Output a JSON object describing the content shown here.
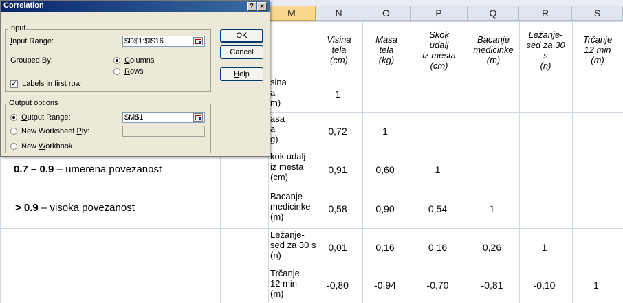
{
  "columns": [
    "M",
    "N",
    "O",
    "P",
    "Q",
    "R",
    "S"
  ],
  "active_column": "M",
  "headers": [
    [
      "Visina",
      "tela",
      "(cm)"
    ],
    [
      "Masa",
      "tela",
      "(kg)"
    ],
    [
      "Skok",
      "udalj",
      "iz mesta",
      "(cm)"
    ],
    [
      "Bacanje",
      "medicinke",
      "(m)"
    ],
    [
      "Ležanje-",
      "sed za 30",
      "s",
      "(n)"
    ],
    [
      "Trčanje",
      "12 min",
      "(m)"
    ]
  ],
  "row_labels": [
    [
      "sina",
      "a",
      "m)"
    ],
    [
      "asa",
      "a",
      "g)"
    ],
    [
      "kok udalj",
      "iz mesta",
      "(cm)"
    ],
    [
      "Bacanje",
      "medicinke",
      "(m)"
    ],
    [
      "Ležanje-",
      "sed za 30 s",
      "(n)"
    ],
    [
      "Trčanje",
      "12 min",
      "(m)"
    ]
  ],
  "matrix": [
    [
      "1"
    ],
    [
      "0,72",
      "1"
    ],
    [
      "0,91",
      "0,60",
      "1"
    ],
    [
      "0,58",
      "0,90",
      "0,54",
      "1"
    ],
    [
      "0,01",
      "0,16",
      "0,16",
      "0,26",
      "1"
    ],
    [
      "-0,80",
      "-0,94",
      "-0,70",
      "-0,81",
      "-0,10",
      "1"
    ]
  ],
  "legend": [
    {
      "bold": "0.7 – 0.9",
      "text": " – umerena povezanost"
    },
    {
      "bold": "> 0.9",
      "text": " – visoka povezanost"
    }
  ],
  "dialog": {
    "title": "Correlation",
    "help_btn": "?",
    "close_btn": "×",
    "input_group": "Input",
    "input_range_label": "Input Range:",
    "input_range_value": "$D$1:$I$16",
    "grouped_by_label": "Grouped By:",
    "columns_label": "Columns",
    "rows_label": "Rows",
    "grouped_by_selected": "Columns",
    "labels_first_row": "Labels in first row",
    "labels_checked": true,
    "output_group": "Output options",
    "output_range_label": "Output Range:",
    "output_range_value": "$M$1",
    "new_ply_label": "New Worksheet Ply:",
    "new_workbook_label": "New Workbook",
    "ok": "OK",
    "cancel": "Cancel",
    "help": "Help"
  }
}
